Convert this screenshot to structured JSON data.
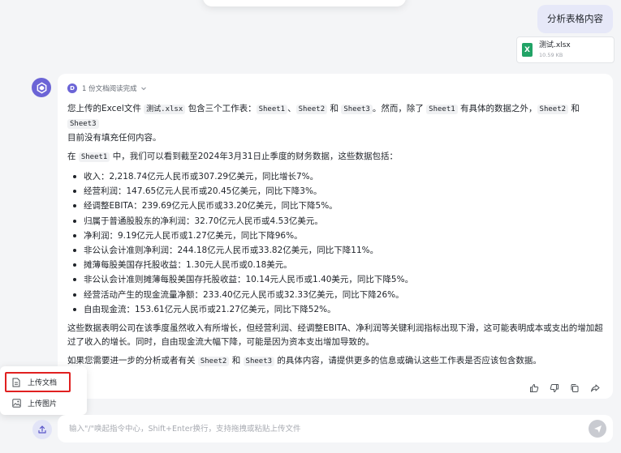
{
  "user_message": "分析表格内容",
  "attachment": {
    "name": "测试.xlsx",
    "size": "10.59 KB",
    "icon": "xlsx-file-icon"
  },
  "doc_read": {
    "badge": "D",
    "label": "1 份文档阅读完成"
  },
  "answer": {
    "intro": {
      "t1": "您上传的Excel文件 ",
      "file_code": "测试.xlsx",
      "t2": " 包含三个工作表：",
      "s1": "Sheet1",
      "sep1": "、",
      "s2": "Sheet2",
      "and1": " 和 ",
      "s3": "Sheet3",
      "t3": "。然而，除了 ",
      "s1b": "Sheet1",
      "t4": " 有具体的数据之外，",
      "s2b": "Sheet2",
      "and2": " 和 ",
      "s3b": "Sheet3",
      "t5": "目前没有填充任何内容。"
    },
    "lead": {
      "t1": "在 ",
      "sheet": "Sheet1",
      "t2": " 中，我们可以看到截至2024年3月31日止季度的财务数据，这些数据包括："
    },
    "items": [
      "收入：2,218.74亿元人民币或307.29亿美元，同比增长7%。",
      "经营利润：147.65亿元人民币或20.45亿美元，同比下降3%。",
      "经调整EBITA：239.69亿元人民币或33.20亿美元，同比下降5%。",
      "归属于普通股股东的净利润：32.70亿元人民币或4.53亿美元。",
      "净利润：9.19亿元人民币或1.27亿美元，同比下降96%。",
      "非公认会计准则净利润：244.18亿元人民币或33.82亿美元，同比下降11%。",
      "摊薄每股美国存托股收益：1.30元人民币或0.18美元。",
      "非公认会计准则摊薄每股美国存托股收益：10.14元人民币或1.40美元，同比下降5%。",
      "经营活动产生的现金流量净额：233.40亿元人民币或32.33亿美元，同比下降26%。",
      "自由现金流：153.61亿元人民币或21.27亿美元，同比下降52%。"
    ],
    "analysis": "这些数据表明公司在该季度虽然收入有所增长，但经营利润、经调整EBITA、净利润等关键利润指标出现下滑，这可能表明成本或支出的增加超过了收入的增长。同时，自由现金流大幅下降，可能是因为资本支出增加导致的。",
    "closing": {
      "t1": "如果您需要进一步的分析或者有关 ",
      "s2": "Sheet2",
      "and": " 和 ",
      "s3": "Sheet3",
      "t2": " 的具体内容，请提供更多的信息或确认这些工作表是否应该包含数据。"
    }
  },
  "actions": [
    "thumbs-up-icon",
    "thumbs-down-icon",
    "copy-icon",
    "share-icon"
  ],
  "upload_menu": {
    "doc_label": "上传文档",
    "img_label": "上传图片"
  },
  "input": {
    "placeholder": "输入\"/\"唤起指令中心，Shift+Enter换行，支持拖拽或粘贴上传文件"
  },
  "colors": {
    "accent": "#6b64d6",
    "user_bubble": "#e6e8f8",
    "highlight_border": "#e02020",
    "excel_green": "#21a366"
  }
}
